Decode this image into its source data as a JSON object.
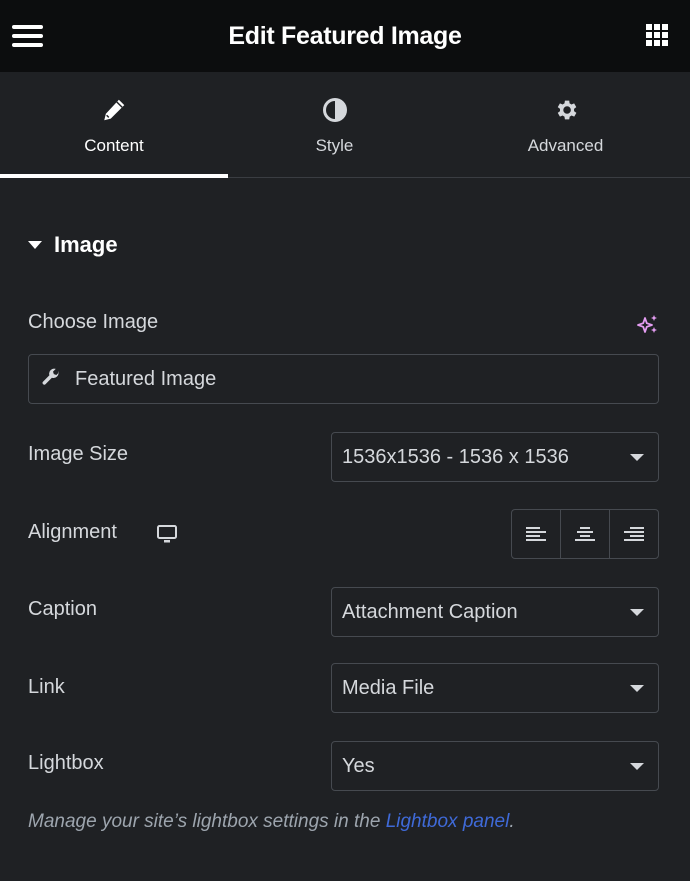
{
  "header": {
    "title": "Edit Featured Image",
    "menu_icon": "hamburger-icon",
    "apps_icon": "grid-icon"
  },
  "tabs": [
    {
      "label": "Content",
      "icon": "pencil-icon",
      "active": true
    },
    {
      "label": "Style",
      "icon": "half-circle-icon",
      "active": false
    },
    {
      "label": "Advanced",
      "icon": "gear-icon",
      "active": false
    }
  ],
  "section": {
    "title": "Image",
    "expanded": true
  },
  "fields": {
    "choose_image": {
      "label": "Choose Image",
      "value": "Featured Image",
      "icon": "wrench-icon",
      "ai_icon": "sparkle-icon"
    },
    "image_size": {
      "label": "Image Size",
      "value": "1536x1536 - 1536 x 1536"
    },
    "alignment": {
      "label": "Alignment",
      "device_icon": "desktop-icon",
      "options": [
        "left",
        "center",
        "right"
      ]
    },
    "caption": {
      "label": "Caption",
      "value": "Attachment Caption"
    },
    "link": {
      "label": "Link",
      "value": "Media File"
    },
    "lightbox": {
      "label": "Lightbox",
      "value": "Yes"
    }
  },
  "note": {
    "text": "Manage your site’s lightbox settings in the ",
    "link_text": "Lightbox panel",
    "suffix": "."
  },
  "colors": {
    "link": "#3f6ad8",
    "ai_accent": "#e49df2",
    "background": "#1f2124",
    "topbar": "#0c0d0e"
  }
}
